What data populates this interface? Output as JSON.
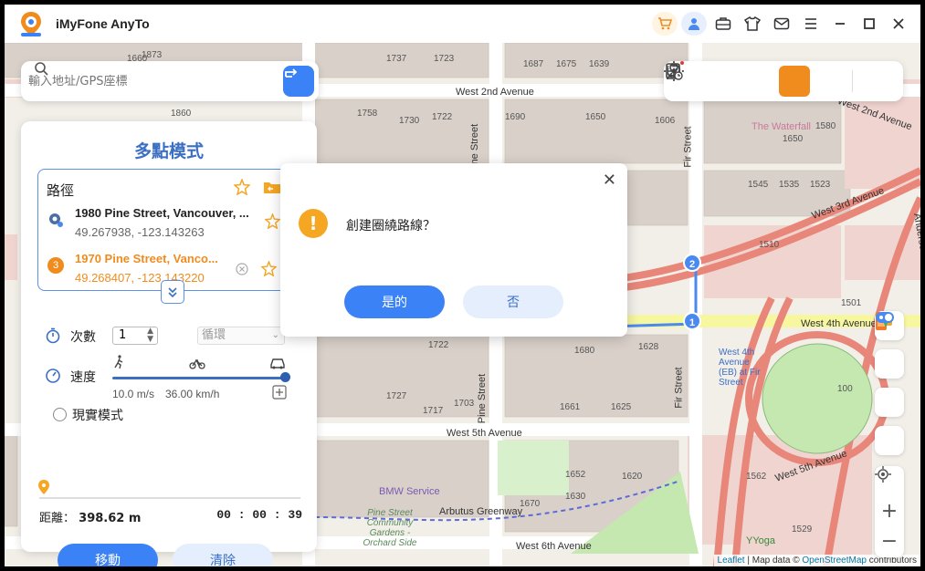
{
  "app": {
    "title": "iMyFone AnyTo"
  },
  "search": {
    "placeholder": "輸入地址/GPS座標"
  },
  "panel": {
    "title": "多點模式",
    "route_heading": "路徑",
    "stops": [
      {
        "name": "1980 Pine Street, Vancouver, ...",
        "coords": "49.267938, -123.143263"
      },
      {
        "index": "3",
        "name": "1970 Pine Street, Vanco...",
        "coords": "49.268407, -123.143220"
      }
    ],
    "count_label": "次數",
    "count_value": "1",
    "loop_label": "循環",
    "speed_label": "速度",
    "speed_ms": "10.0 m/s",
    "speed_kmh": "36.00 km/h",
    "realistic_label": "現實模式",
    "distance_label": "距離：",
    "distance_value": "398.62 m",
    "timer": "00 : 00 : 39",
    "move_label": "移動",
    "clear_label": "清除"
  },
  "dialog": {
    "message": "創建圈繞路線？",
    "yes_label": "是的",
    "no_label": "否"
  },
  "map": {
    "streets": [
      "West 2nd Avenue",
      "West 3rd Avenue",
      "West 4th Avenue",
      "West 5th Avenue",
      "West 6th Avenue",
      "West 2nd Avenue",
      "West 5th Avenue",
      "Pine Street",
      "Pine Street",
      "Fir Street",
      "Fir Street",
      "Arbutus Greenway",
      "Anderson Street"
    ],
    "places": [
      "The Waterfall",
      "BMW Service",
      "Pine Street Community Gardens - Orchard Side",
      "West 4th Avenue (EB) at Fir Street",
      "YYoga"
    ],
    "numbers": [
      "1737",
      "1723",
      "1687",
      "1675",
      "1639",
      "1758",
      "1730",
      "1722",
      "1690",
      "1650",
      "1606",
      "1650",
      "1580",
      "1545",
      "1535",
      "1523",
      "1510",
      "1501",
      "1722",
      "1680",
      "1628",
      "1727",
      "1703",
      "1717",
      "1661",
      "1625",
      "1670",
      "1652",
      "1620",
      "1630",
      "1562",
      "1529",
      "100",
      "1660",
      "1860",
      "1873"
    ],
    "markers": [
      "1",
      "2"
    ],
    "attribution_leaflet": "Leaflet",
    "attribution_mid": " | Map data © ",
    "attribution_osm": "OpenStreetMap",
    "attribution_end": " contributors"
  }
}
